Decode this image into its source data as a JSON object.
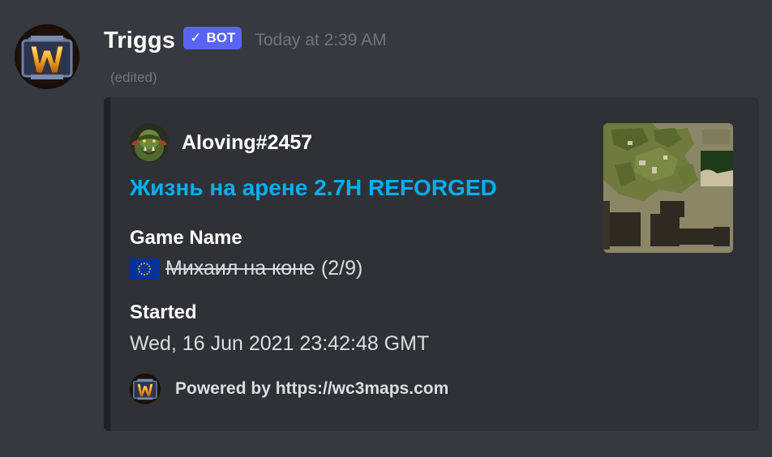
{
  "message": {
    "author_name": "Triggs",
    "bot_tag": "BOT",
    "bot_check": "✓",
    "timestamp": "Today at 2:39 AM",
    "edited_label": "(edited)"
  },
  "embed": {
    "author_name": "Aloving#2457",
    "title": "Жизнь на арене 2.7H REFORGED",
    "fields": [
      {
        "name": "Game Name",
        "flag_icon": "eu-flag-icon",
        "value_struck": "Михаил на коне",
        "player_count": "(2/9)"
      },
      {
        "name": "Started",
        "value": "Wed, 16 Jun 2021 23:42:48 GMT"
      }
    ],
    "footer_text": "Powered by https://wc3maps.com",
    "accent_color": "#202225",
    "title_color": "#00aff4"
  }
}
